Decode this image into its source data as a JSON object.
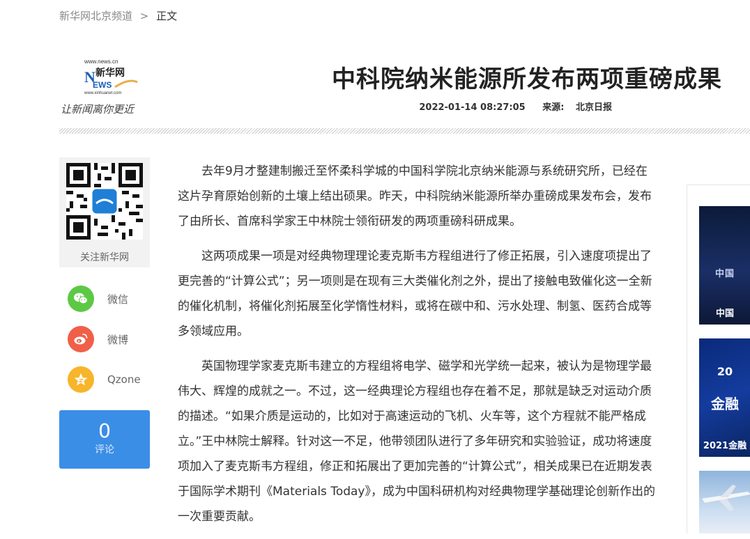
{
  "breadcrumb": {
    "site": "新华网北京频道",
    "separator": ">",
    "current": "正文"
  },
  "logo": {
    "url_top": "www.news.cn",
    "brand": "新华网",
    "news": "NEWS",
    "url_bottom": "www.xinhuanet.com",
    "slogan": "让新闻离你更近"
  },
  "article": {
    "title": "中科院纳米能源所发布两项重磅成果",
    "datetime": "2022-01-14 08:27:05",
    "source_label": "来源:",
    "source": "北京日报",
    "paragraphs": [
      "去年9月才整建制搬迁至怀柔科学城的中国科学院北京纳米能源与系统研究所，已经在这片孕育原始创新的土壤上结出硕果。昨天，中科院纳米能源所举办重磅成果发布会，发布了由所长、首席科学家王中林院士领衔研发的两项重磅科研成果。",
      "这两项成果一项是对经典物理理论麦克斯韦方程组进行了修正拓展，引入速度项提出了更完善的“计算公式”；另一项则是在现有三大类催化剂之外，提出了接触电致催化这一全新的催化机制，将催化剂拓展至化学惰性材料，或将在碳中和、污水处理、制氢、医药合成等多领域应用。",
      "英国物理学家麦克斯韦建立的方程组将电学、磁学和光学统一起来，被认为是物理学最伟大、辉煌的成就之一。不过，这一经典理论方程组也存在着不足，那就是缺乏对运动介质的描述。“如果介质是运动的，比如对于高速运动的飞机、火车等，这个方程就不能严格成立。”王中林院士解释。针对这一不足，他带领团队进行了多年研究和实验验证，成功将速度项加入了麦克斯韦方程组，修正和拓展出了更加完善的“计算公式”，相关成果已在近期发表于国际学术期刊《Materials Today》，成为中国科研机构对经典物理学基础理论创新作出的一次重要贡献。"
    ]
  },
  "sidebar": {
    "qr_label": "关注新华网",
    "share": [
      {
        "label": "微信",
        "icon": "wechat-icon",
        "color": "#5cc945"
      },
      {
        "label": "微博",
        "icon": "weibo-icon",
        "color": "#f06048"
      },
      {
        "label": "Qzone",
        "icon": "qzone-icon",
        "color": "#f7b52b"
      }
    ],
    "comment_count": "0",
    "comment_label": "评论"
  },
  "right_column": {
    "items": [
      {
        "overlay": "中国",
        "caption": "中国"
      },
      {
        "overlay": "金融",
        "year": "20",
        "caption": "2021金融"
      },
      {
        "caption": ""
      }
    ]
  }
}
